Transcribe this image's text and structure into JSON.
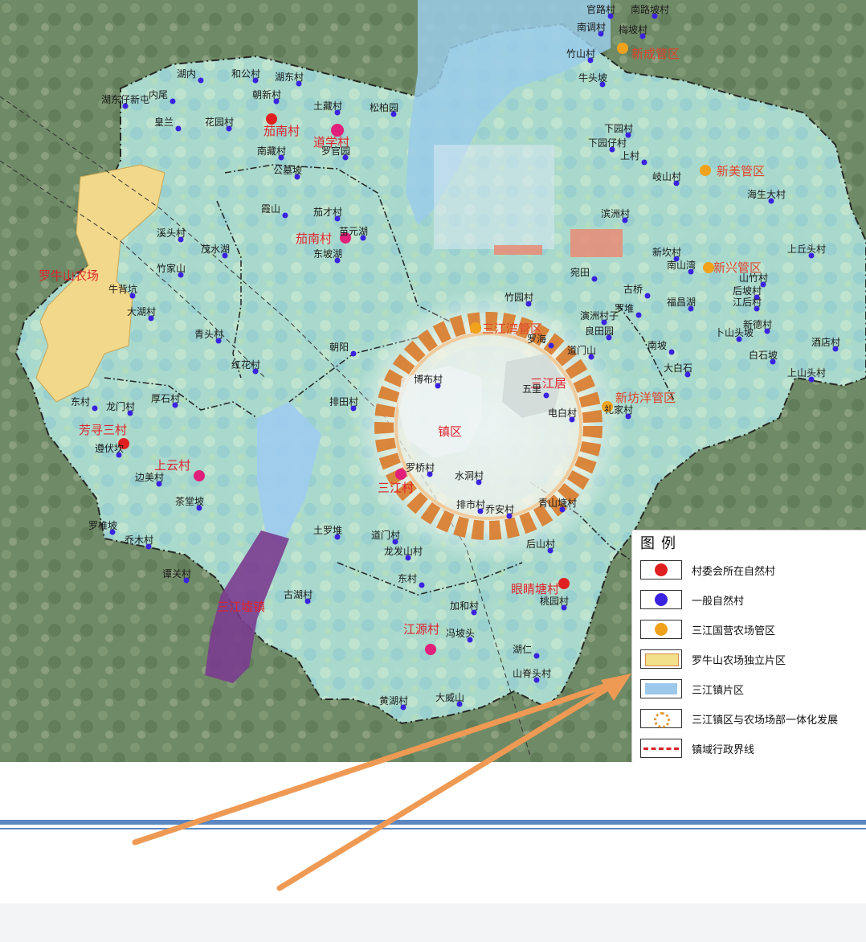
{
  "map": {
    "regions": {
      "luoniushan": "罗牛山农场",
      "sanjiangju": "三江居",
      "zhenqu": "镇区"
    },
    "admin_points": [
      {
        "label": "茄南村",
        "kind": "red"
      },
      {
        "label": "道学村",
        "kind": "red"
      },
      {
        "label": "茄南村",
        "kind": "red"
      },
      {
        "label": "芳寻三村",
        "kind": "red"
      },
      {
        "label": "上云村",
        "kind": "red"
      },
      {
        "label": "眼睛塘村",
        "kind": "red"
      },
      {
        "label": "江源村",
        "kind": "red"
      },
      {
        "label": "三江村",
        "kind": "red"
      }
    ],
    "farm_points": [
      {
        "label": "新成管区"
      },
      {
        "label": "新美管区"
      },
      {
        "label": "新兴管区"
      },
      {
        "label": "三江湾管区"
      },
      {
        "label": "新坊洋管区"
      }
    ],
    "other_labels": [
      "三江墟镇"
    ],
    "villages": [
      "官路村",
      "南路坡村",
      "南调村",
      "梅坡村",
      "竹山村",
      "牛头坡",
      "湖内",
      "和公村",
      "湖东村",
      "内尾",
      "朝新村",
      "湖东仔新屯",
      "皇兰",
      "花园村",
      "土藏村",
      "松柏园",
      "南藏村",
      "罗官园",
      "公墓坡",
      "霞山",
      "茄才村",
      "苗元湖",
      "溪头村",
      "茂水湖",
      "东坡湖",
      "竹家山",
      "牛背坑",
      "大湖村",
      "青头村",
      "红花村",
      "朝阳",
      "排田村",
      "博布村",
      "东村",
      "龙门村",
      "厚石村",
      "遵伏坎",
      "边美村",
      "茶堂坡",
      "罗椎坡",
      "乔木村",
      "谭关村",
      "古湖村",
      "土罗堆",
      "道门村",
      "龙发山村",
      "东村",
      "加和村",
      "冯坡头",
      "黄湖村",
      "大威山",
      "罗桥村",
      "水洞村",
      "排市村",
      "乔安村",
      "青山塘村",
      "后山村",
      "桃园村",
      "湖仁",
      "山脊头村",
      "下园村",
      "下园仔村",
      "上村",
      "岐山村",
      "海生大村",
      "滨洲村",
      "新坎村",
      "南山湾",
      "古桥",
      "福昌湖",
      "罗堆",
      "良田园",
      "道门山",
      "南坡",
      "大白石",
      "白石坡",
      "上山头村",
      "酒店村",
      "上丘头村",
      "山竹村",
      "后坡村",
      "江后村",
      "卜山头坡",
      "新德村",
      "竹园村",
      "五里",
      "礼家村",
      "电白村",
      "宛田",
      "演洲村子",
      "罗海",
      "兵营村"
    ]
  },
  "legend": {
    "title": "图例",
    "items": [
      {
        "label": "村委会所在自然村",
        "symbol": "red-dot",
        "color": "#e02020"
      },
      {
        "label": "一般自然村",
        "symbol": "blue-dot",
        "color": "#3a22e0"
      },
      {
        "label": "三江国营农场管区",
        "symbol": "orange-dot",
        "color": "#f0a21c"
      },
      {
        "label": "罗牛山农场独立片区",
        "symbol": "yellow-box",
        "color": "#f3e08a"
      },
      {
        "label": "三江镇片区",
        "symbol": "blue-box",
        "color": "#9cc8ec"
      },
      {
        "label": "三江镇区与农场场部一体化发展",
        "symbol": "dotted-ring",
        "color": "#e39a3a"
      },
      {
        "label": "镇域行政界线",
        "symbol": "boundary-line",
        "color": "#d62424"
      }
    ]
  },
  "colors": {
    "satellite": "#6f8a66",
    "zone": "#a9ddd0",
    "lake": "#8fc3e6",
    "farm": "#f2d88a",
    "purple": "#7a3c8f",
    "ring": "#d97a2a",
    "arrow": "#ef9a54",
    "rule": "#5b86c2"
  }
}
